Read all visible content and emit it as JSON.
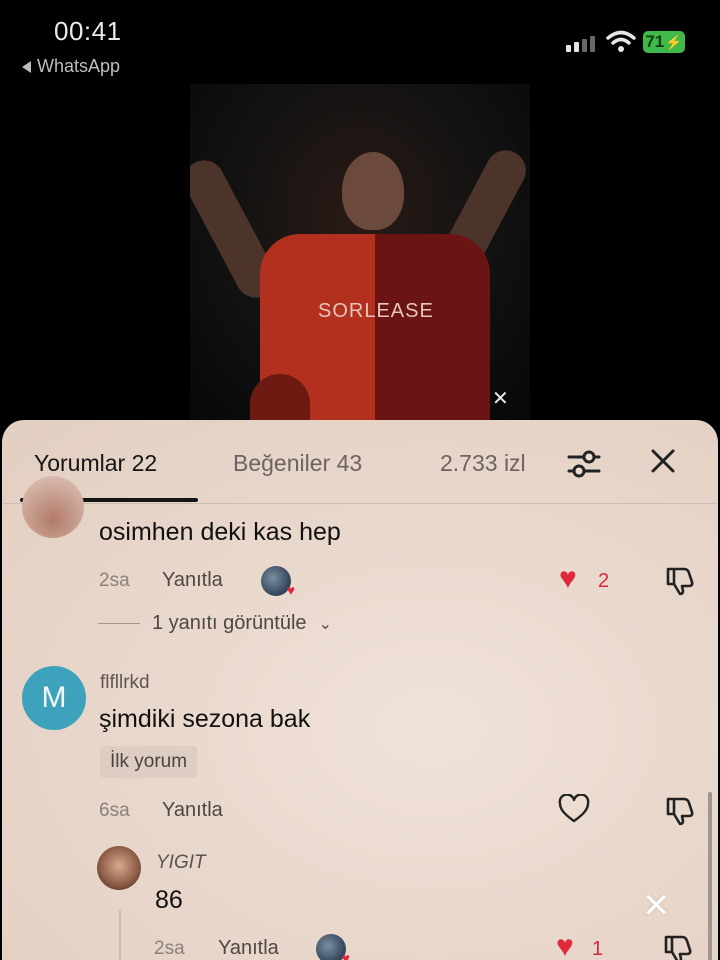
{
  "status_bar": {
    "time": "00:41",
    "back_app": "WhatsApp",
    "battery": "71"
  },
  "video": {
    "sponsor_text": "SORLEASE",
    "watermark_icon": "capcut-icon"
  },
  "tabs": {
    "comments": "Yorumlar 22",
    "likes": "Beğeniler 43",
    "views": "2.733 izl",
    "filter_icon": "sliders-icon",
    "close_icon": "close-icon"
  },
  "comments": [
    {
      "text": "osimhen deki kas hep",
      "time": "2sa",
      "reply": "Yanıtla",
      "likes": "2",
      "view_replies": "1 yanıtı görüntüle"
    },
    {
      "avatar_letter": "M",
      "username": "flfllrkd",
      "text": "şimdiki sezona bak",
      "badge": "İlk yorum",
      "time": "6sa",
      "reply": "Yanıtla"
    }
  ],
  "reply": {
    "username": "YIGIT",
    "text": "86",
    "time": "2sa",
    "reply": "Yanıtla",
    "likes": "1"
  },
  "colors": {
    "sheet_bg": "#ecdcd1",
    "like_red": "#e0293a",
    "avatar_m": "#3fa2bc",
    "battery_green": "#3fb94a"
  }
}
